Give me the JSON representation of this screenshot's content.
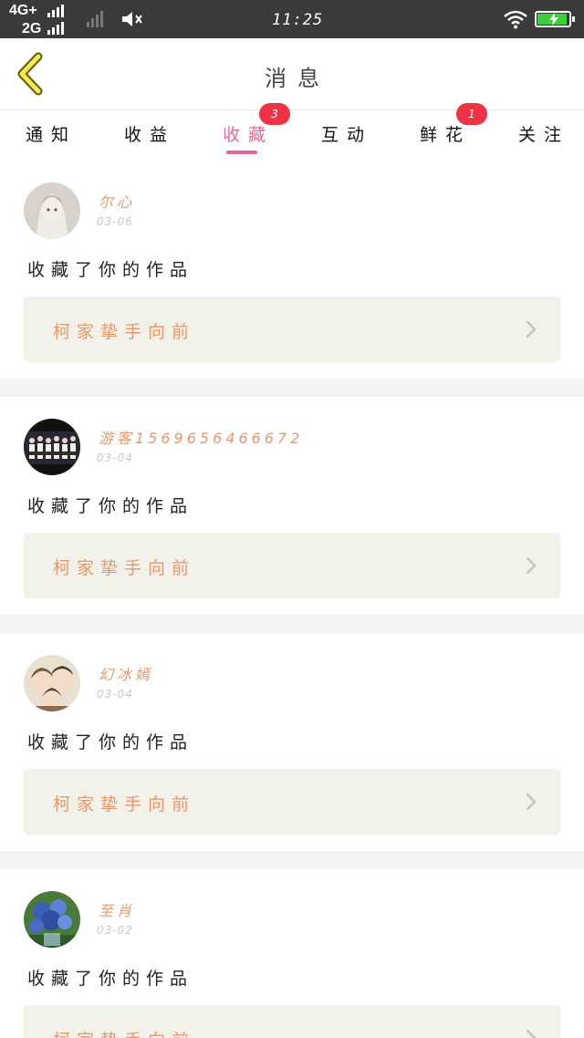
{
  "status_bar": {
    "network_1": "4G+",
    "network_2": "2G",
    "time": "11:25",
    "battery_level": 0.95,
    "icons": [
      "signal-icon",
      "mute-speaker-icon",
      "wifi-icon",
      "battery-charging-icon"
    ]
  },
  "header": {
    "title": "消息",
    "back_icon": "chevron-left-icon"
  },
  "tabs": [
    {
      "label": "通知",
      "badge": "",
      "active": false
    },
    {
      "label": "收益",
      "badge": "",
      "active": false
    },
    {
      "label": "收藏",
      "badge": "3",
      "active": true
    },
    {
      "label": "互动",
      "badge": "",
      "active": false
    },
    {
      "label": "鲜花",
      "badge": "1",
      "active": false
    },
    {
      "label": "关注",
      "badge": "",
      "active": false
    }
  ],
  "colors": {
    "accent": "#e0679b",
    "badge": "#ee3344",
    "username": "#e8986a",
    "work_box": "#f2f2ea"
  },
  "notifications": [
    {
      "username": "尔心",
      "date": "03-06",
      "action": "收藏了你的作品",
      "work_title": "柯家挚手向前"
    },
    {
      "username": "游客1569656466672",
      "date": "03-04",
      "action": "收藏了你的作品",
      "work_title": "柯家挚手向前"
    },
    {
      "username": "幻冰嫣",
      "date": "03-04",
      "action": "收藏了你的作品",
      "work_title": "柯家挚手向前"
    },
    {
      "username": "至肖",
      "date": "03-02",
      "action": "收藏了你的作品",
      "work_title": "柯家挚手向前"
    }
  ]
}
